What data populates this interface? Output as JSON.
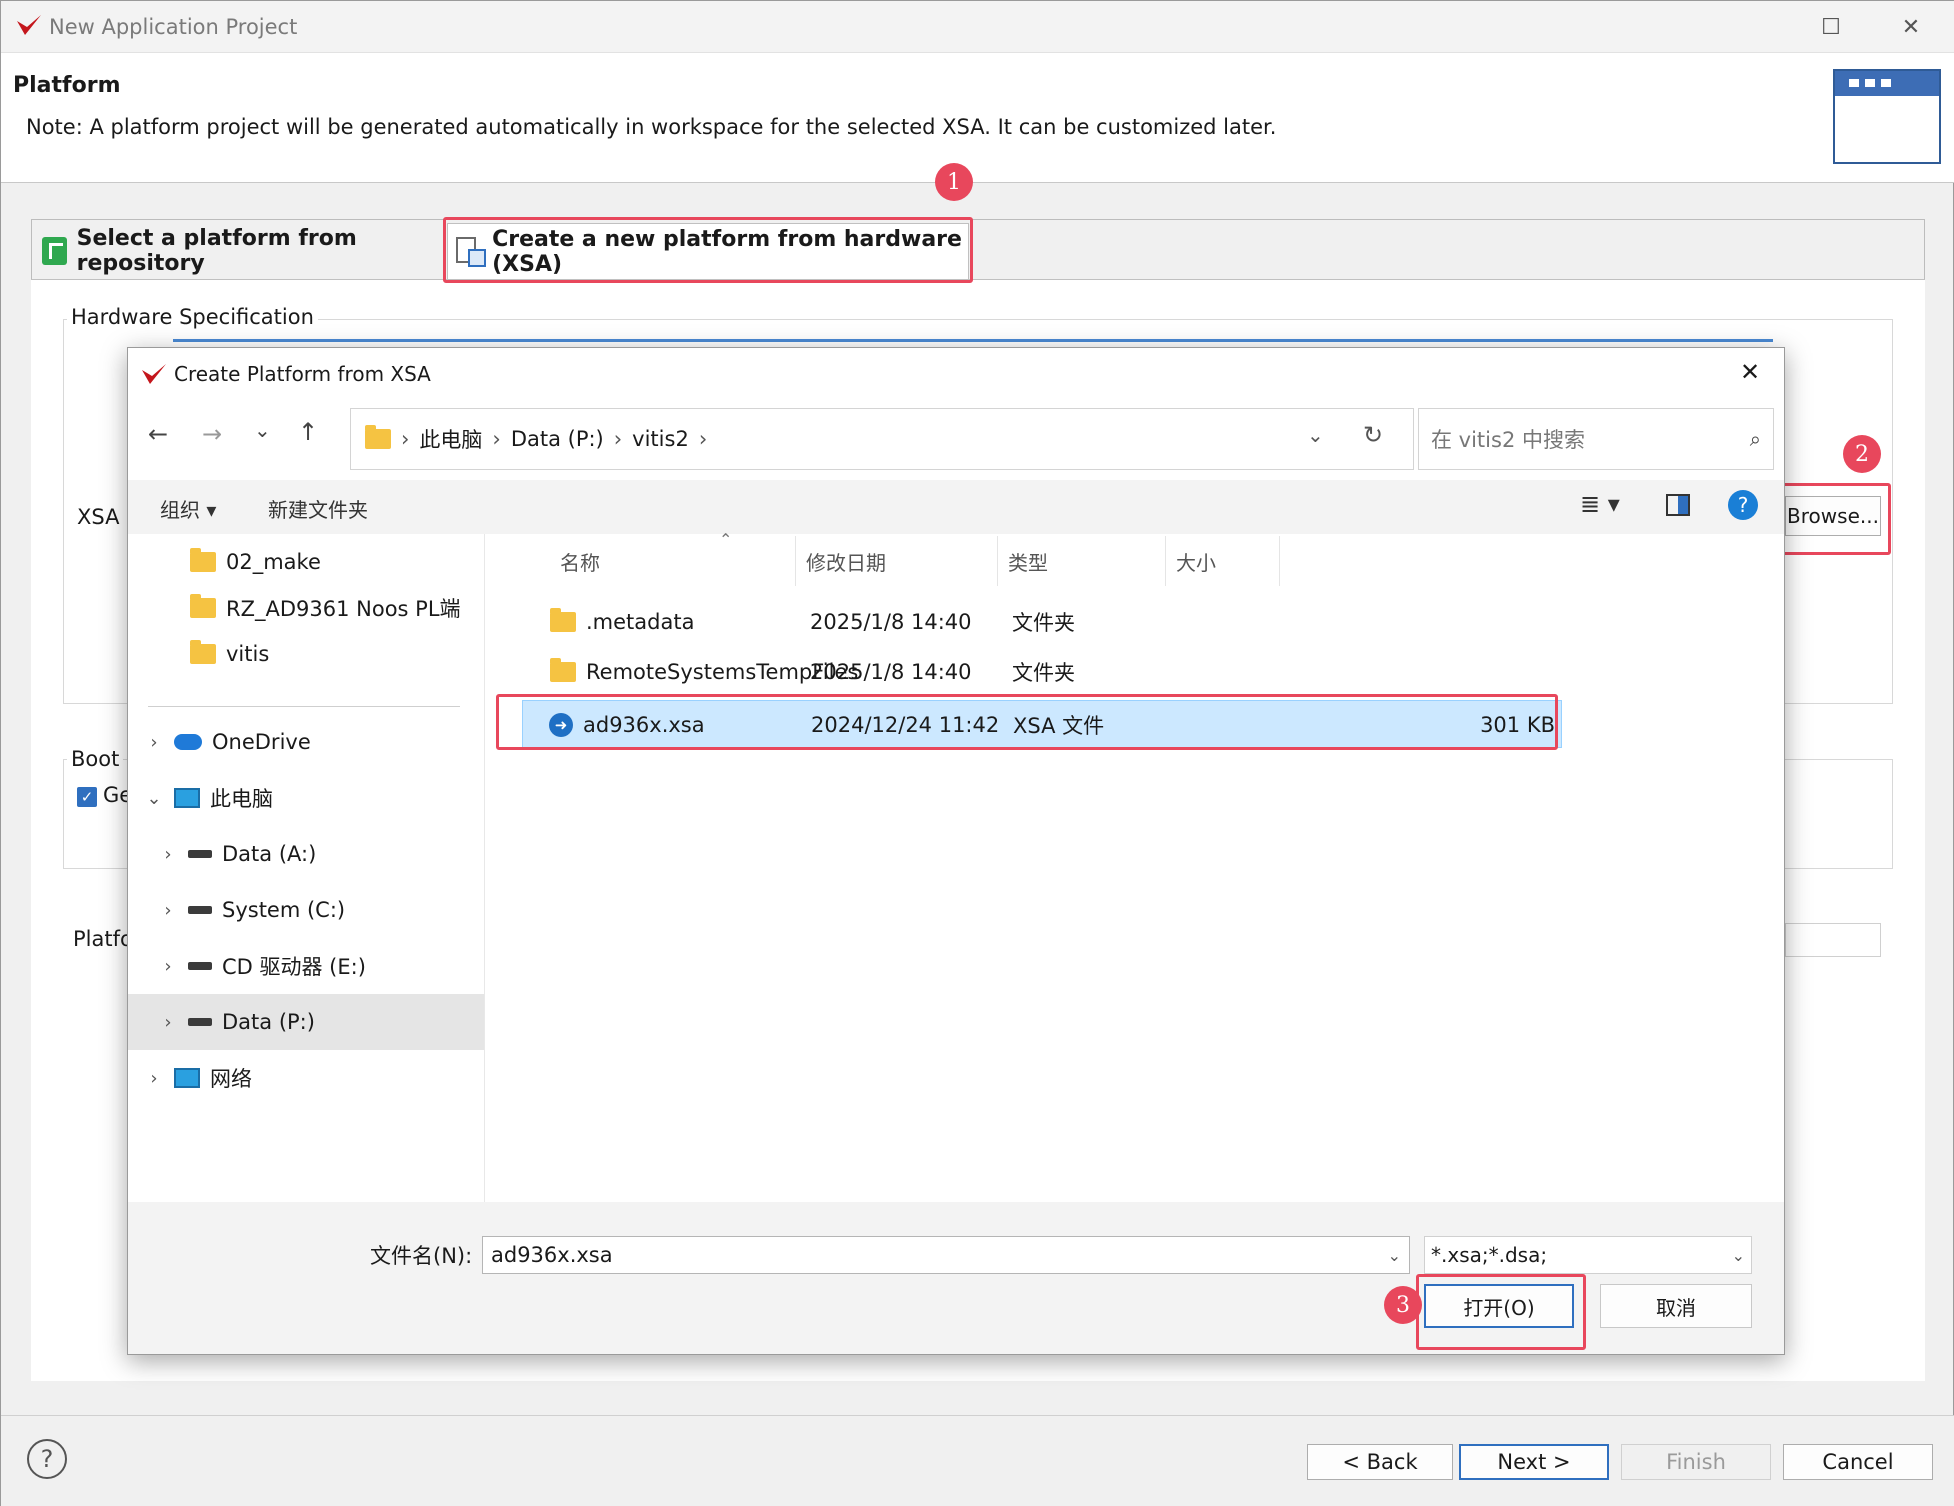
{
  "window": {
    "title": "New Application Project"
  },
  "header": {
    "title": "Platform",
    "note": "Note: A platform project will be generated automatically in workspace for the selected XSA. It can be customized later."
  },
  "tabs": [
    {
      "label": "Select a platform from repository"
    },
    {
      "label": "Create a new platform from hardware (XSA)"
    }
  ],
  "hardware": {
    "group_label": "Hardware Specification",
    "xsa_label": "XSA I",
    "browse_label": "Browse..."
  },
  "boot": {
    "group_label": "Boot",
    "checkbox_label": "Ge"
  },
  "platform_label": "Platfo",
  "badges": [
    "1",
    "2",
    "3"
  ],
  "dialog": {
    "title": "Create Platform from XSA",
    "breadcrumb": [
      "此电脑",
      "Data (P:)",
      "vitis2"
    ],
    "search_placeholder": "在 vitis2 中搜索",
    "toolbar": {
      "organize": "组织",
      "new_folder": "新建文件夹"
    },
    "tree": [
      {
        "label": "02_make",
        "icon": "folder-icon"
      },
      {
        "label": "RZ_AD9361 Noos PL端",
        "icon": "folder-icon"
      },
      {
        "label": "vitis",
        "icon": "folder-icon"
      },
      {
        "label": "OneDrive",
        "icon": "cloud-icon"
      },
      {
        "label": "此电脑",
        "icon": "computer-icon"
      },
      {
        "label": "Data (A:)",
        "icon": "drive-icon"
      },
      {
        "label": "System (C:)",
        "icon": "drive-icon"
      },
      {
        "label": "CD 驱动器 (E:)",
        "icon": "cd-drive-icon"
      },
      {
        "label": "Data (P:)",
        "icon": "drive-icon"
      },
      {
        "label": "网络",
        "icon": "network-icon"
      }
    ],
    "columns": [
      "名称",
      "修改日期",
      "类型",
      "大小"
    ],
    "files": [
      {
        "name": ".metadata",
        "date": "2025/1/8 14:40",
        "type": "文件夹",
        "size": ""
      },
      {
        "name": "RemoteSystemsTempFiles",
        "date": "2025/1/8 14:40",
        "type": "文件夹",
        "size": ""
      },
      {
        "name": "ad936x.xsa",
        "date": "2024/12/24 11:42",
        "type": "XSA 文件",
        "size": "301 KB"
      }
    ],
    "filename_label": "文件名(N):",
    "filename_value": "ad936x.xsa",
    "filter_value": "*.xsa;*.dsa;",
    "open_label": "打开(O)",
    "cancel_label": "取消"
  },
  "footer": {
    "back": "< Back",
    "next": "Next >",
    "finish": "Finish",
    "cancel": "Cancel"
  },
  "colors": {
    "accent": "#3d6db5",
    "highlight": "#e8475c",
    "selection": "#cce8ff"
  }
}
